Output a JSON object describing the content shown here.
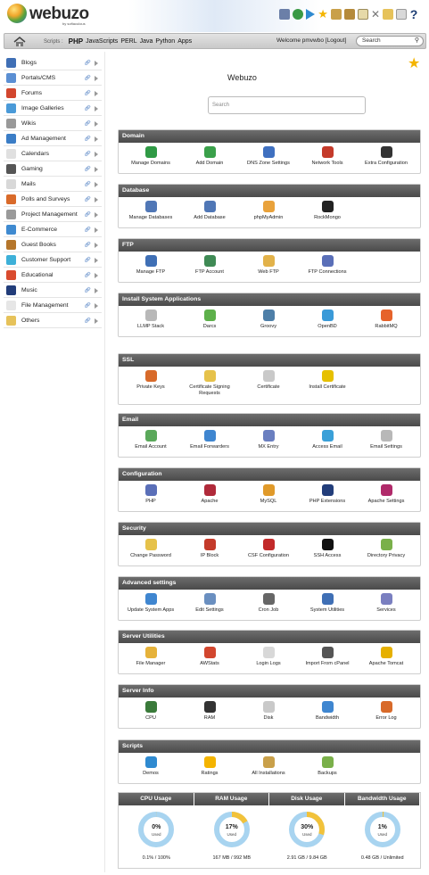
{
  "header": {
    "logo_text": "webuzo",
    "logo_sub": "by softaculous",
    "welcome": "Welcome pmvwbo [Logout]",
    "search_value": "Search"
  },
  "nav": {
    "scripts_label": "Scripts :",
    "links": [
      "PHP",
      "JavaScripts",
      "PERL",
      "Java",
      "Python",
      "Apps"
    ]
  },
  "sidebar": {
    "items": [
      {
        "label": "Blogs",
        "icon": "person-icon",
        "color": "#3f6fb5"
      },
      {
        "label": "Portals/CMS",
        "icon": "portal-icon",
        "color": "#5b8fd3"
      },
      {
        "label": "Forums",
        "icon": "forum-icon",
        "color": "#d2462e"
      },
      {
        "label": "Image Galleries",
        "icon": "gallery-icon",
        "color": "#4a9ad8"
      },
      {
        "label": "Wikis",
        "icon": "wiki-icon",
        "color": "#999999"
      },
      {
        "label": "Ad Management",
        "icon": "ad-icon",
        "color": "#3b7dc6"
      },
      {
        "label": "Calendars",
        "icon": "calendar-icon",
        "color": "#e0e0e0"
      },
      {
        "label": "Gaming",
        "icon": "gaming-icon",
        "color": "#555555"
      },
      {
        "label": "Mails",
        "icon": "mail-icon",
        "color": "#d8d8d8"
      },
      {
        "label": "Polls and Surveys",
        "icon": "poll-icon",
        "color": "#d96a2a"
      },
      {
        "label": "Project Management",
        "icon": "project-icon",
        "color": "#9a9a9a"
      },
      {
        "label": "E-Commerce",
        "icon": "cart-icon",
        "color": "#3f8ad0"
      },
      {
        "label": "Guest Books",
        "icon": "guestbook-icon",
        "color": "#b5762b"
      },
      {
        "label": "Customer Support",
        "icon": "support-icon",
        "color": "#3db0d8"
      },
      {
        "label": "Educational",
        "icon": "education-icon",
        "color": "#d94b2e"
      },
      {
        "label": "Music",
        "icon": "music-icon",
        "color": "#223d7a"
      },
      {
        "label": "File Management",
        "icon": "file-icon",
        "color": "#e6e6e6"
      },
      {
        "label": "Others",
        "icon": "folder-icon",
        "color": "#e6c25a"
      }
    ]
  },
  "main": {
    "title": "Webuzo",
    "search_placeholder": "Search",
    "panels": [
      {
        "name": "domain",
        "title": "Domain",
        "tiles": [
          {
            "label": "Manage Domains",
            "icon": "globe-icon",
            "color": "#2f9a45"
          },
          {
            "label": "Add Domain",
            "icon": "add-globe-icon",
            "color": "#3aa04a"
          },
          {
            "label": "DNS Zone Settings",
            "icon": "dns-icon",
            "color": "#3f70c0"
          },
          {
            "label": "Network Tools",
            "icon": "tools-icon",
            "color": "#c43a2a"
          },
          {
            "label": "Extra Configuration",
            "icon": "gear-icon",
            "color": "#333333"
          }
        ]
      },
      {
        "name": "database",
        "title": "Database",
        "tiles": [
          {
            "label": "Manage Databases",
            "icon": "database-icon",
            "color": "#5077b6"
          },
          {
            "label": "Add Database",
            "icon": "add-database-icon",
            "color": "#5077b6"
          },
          {
            "label": "phpMyAdmin",
            "icon": "phpmyadmin-icon",
            "color": "#e9a23b"
          },
          {
            "label": "RockMongo",
            "icon": "rockmongo-icon",
            "color": "#222222"
          }
        ]
      },
      {
        "name": "ftp",
        "title": "FTP",
        "tiles": [
          {
            "label": "Manage FTP",
            "icon": "ftp-icon",
            "color": "#3f6fb5"
          },
          {
            "label": "FTP Account",
            "icon": "ftp-account-icon",
            "color": "#3f8a55"
          },
          {
            "label": "Web FTP",
            "icon": "web-ftp-icon",
            "color": "#e2b24a"
          },
          {
            "label": "FTP Connections",
            "icon": "ftp-connections-icon",
            "color": "#5a6fb8"
          }
        ]
      },
      {
        "name": "install-system-apps",
        "title": "Install System Applications",
        "tiles": [
          {
            "label": "LLMP Stack",
            "icon": "llmp-icon",
            "color": "#b8b8b8"
          },
          {
            "label": "Darcs",
            "icon": "darcs-icon",
            "color": "#5db04a"
          },
          {
            "label": "Groovy",
            "icon": "groovy-icon",
            "color": "#4e7fa8"
          },
          {
            "label": "OpenBD",
            "icon": "openbd-icon",
            "color": "#3a9ad8"
          },
          {
            "label": "RabbitMQ",
            "icon": "rabbitmq-icon",
            "color": "#e6632b"
          }
        ]
      },
      {
        "name": "ssl",
        "title": "SSL",
        "tiles": [
          {
            "label": "Private Keys",
            "icon": "key-icon",
            "color": "#d86a2a"
          },
          {
            "label": "Certificate Signing Requests",
            "icon": "csr-icon",
            "color": "#e6c24a"
          },
          {
            "label": "Certificate",
            "icon": "certificate-icon",
            "color": "#c9c9c9"
          },
          {
            "label": "Install Certificate",
            "icon": "install-cert-icon",
            "color": "#e6c000"
          }
        ]
      },
      {
        "name": "email",
        "title": "Email",
        "tiles": [
          {
            "label": "Email Account",
            "icon": "email-account-icon",
            "color": "#5aa85a"
          },
          {
            "label": "Email Forwarders",
            "icon": "email-forward-icon",
            "color": "#3f86d0"
          },
          {
            "label": "MX Entry",
            "icon": "mx-icon",
            "color": "#6a7fc0"
          },
          {
            "label": "Access Email",
            "icon": "access-email-icon",
            "color": "#3aa0d8"
          },
          {
            "label": "Email Settings",
            "icon": "email-settings-icon",
            "color": "#b8b8b8"
          }
        ]
      },
      {
        "name": "configuration",
        "title": "Configuration",
        "tiles": [
          {
            "label": "PHP",
            "icon": "php-icon",
            "color": "#5a6fb8"
          },
          {
            "label": "Apache",
            "icon": "apache-icon",
            "color": "#b02a3a"
          },
          {
            "label": "MySQL",
            "icon": "mysql-icon",
            "color": "#e09a2a"
          },
          {
            "label": "PHP Extensions",
            "icon": "php-extensions-icon",
            "color": "#223d7a"
          },
          {
            "label": "Apache Settings",
            "icon": "apache-settings-icon",
            "color": "#b02a6a"
          }
        ]
      },
      {
        "name": "security",
        "title": "Security",
        "tiles": [
          {
            "label": "Change Password",
            "icon": "password-icon",
            "color": "#e6c24a"
          },
          {
            "label": "IP Block",
            "icon": "ip-block-icon",
            "color": "#c43a2a"
          },
          {
            "label": "CSF Configuration",
            "icon": "csf-icon",
            "color": "#c22a2a"
          },
          {
            "label": "SSH Access",
            "icon": "ssh-icon",
            "color": "#111111"
          },
          {
            "label": "Directory Privacy",
            "icon": "directory-privacy-icon",
            "color": "#7ab04a"
          }
        ]
      },
      {
        "name": "advanced-settings",
        "title": "Advanced settings",
        "tiles": [
          {
            "label": "Update System Apps",
            "icon": "update-icon",
            "color": "#3f86d0"
          },
          {
            "label": "Edit Settings",
            "icon": "edit-settings-icon",
            "color": "#6a8fc0"
          },
          {
            "label": "Cron Job",
            "icon": "cron-icon",
            "color": "#666666"
          },
          {
            "label": "System Utilities",
            "icon": "system-utilities-icon",
            "color": "#3f6fb5"
          },
          {
            "label": "Services",
            "icon": "services-icon",
            "color": "#7a7fc0"
          }
        ]
      },
      {
        "name": "server-utilities",
        "title": "Server Utilities",
        "tiles": [
          {
            "label": "File Manager",
            "icon": "file-manager-icon",
            "color": "#e6b23a"
          },
          {
            "label": "AWStats",
            "icon": "awstats-icon",
            "color": "#d2462e"
          },
          {
            "label": "Login Logs",
            "icon": "login-logs-icon",
            "color": "#d8d8d8"
          },
          {
            "label": "Import From cPanel",
            "icon": "import-icon",
            "color": "#555555"
          },
          {
            "label": "Apache Tomcat",
            "icon": "tomcat-icon",
            "color": "#e6b000"
          }
        ]
      },
      {
        "name": "server-info",
        "title": "Server Info",
        "tiles": [
          {
            "label": "CPU",
            "icon": "cpu-icon",
            "color": "#3a7a3a"
          },
          {
            "label": "RAM",
            "icon": "ram-icon",
            "color": "#333333"
          },
          {
            "label": "Disk",
            "icon": "disk-icon",
            "color": "#c9c9c9"
          },
          {
            "label": "Bandwidth",
            "icon": "bandwidth-icon",
            "color": "#3f86d0"
          },
          {
            "label": "Error Log",
            "icon": "error-log-icon",
            "color": "#d86a2a"
          }
        ]
      },
      {
        "name": "scripts",
        "title": "Scripts",
        "tiles": [
          {
            "label": "Demos",
            "icon": "play-icon",
            "color": "#2f8ad0"
          },
          {
            "label": "Ratings",
            "icon": "star-icon",
            "color": "#f4b400"
          },
          {
            "label": "All Installations",
            "icon": "installations-icon",
            "color": "#c9a04a"
          },
          {
            "label": "Backups",
            "icon": "backups-icon",
            "color": "#7ab04a"
          }
        ]
      }
    ]
  },
  "usage": [
    {
      "header": "CPU Usage",
      "pct": "0%",
      "used": "Used",
      "detail": "0.1% / 100%",
      "value": 0.001
    },
    {
      "header": "RAM Usage",
      "pct": "17%",
      "used": "Used",
      "detail": "167 MB / 992 MB",
      "value": 0.17
    },
    {
      "header": "Disk Usage",
      "pct": "30%",
      "used": "Used",
      "detail": "2.91 GB / 9.84 GB",
      "value": 0.3
    },
    {
      "header": "Bandwidth Usage",
      "pct": "1%",
      "used": "Used",
      "detail": "0.48 GB / Unlimited",
      "value": 0.01
    }
  ]
}
